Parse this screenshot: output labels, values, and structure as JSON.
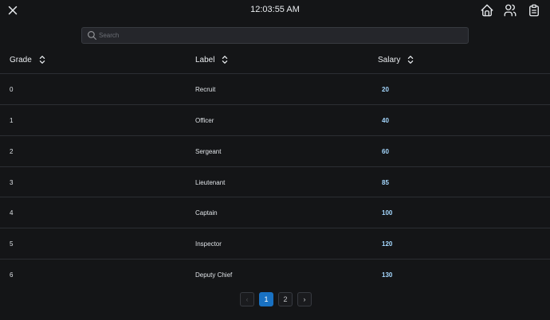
{
  "header": {
    "time": "12:03:55 AM"
  },
  "search": {
    "placeholder": "Search",
    "value": ""
  },
  "table": {
    "columns": [
      "Grade",
      "Label",
      "Salary"
    ],
    "rows": [
      {
        "grade": "0",
        "label": "Recruit",
        "salary": "20"
      },
      {
        "grade": "1",
        "label": "Officer",
        "salary": "40"
      },
      {
        "grade": "2",
        "label": "Sergeant",
        "salary": "60"
      },
      {
        "grade": "3",
        "label": "Lieutenant",
        "salary": "85"
      },
      {
        "grade": "4",
        "label": "Captain",
        "salary": "100"
      },
      {
        "grade": "5",
        "label": "Inspector",
        "salary": "120"
      },
      {
        "grade": "6",
        "label": "Deputy Chief",
        "salary": "130"
      }
    ]
  },
  "pagination": {
    "prev": "‹",
    "pages": [
      "1",
      "2"
    ],
    "current": "1",
    "next": "›"
  },
  "colors": {
    "background": "#141517",
    "accent": "#1971c2",
    "salary": "#a5d8ff"
  },
  "icons": {
    "close": "close-icon",
    "home": "home-icon",
    "users": "users-icon",
    "clipboard": "clipboard-icon",
    "search": "search-icon",
    "sort": "selector-icon"
  }
}
